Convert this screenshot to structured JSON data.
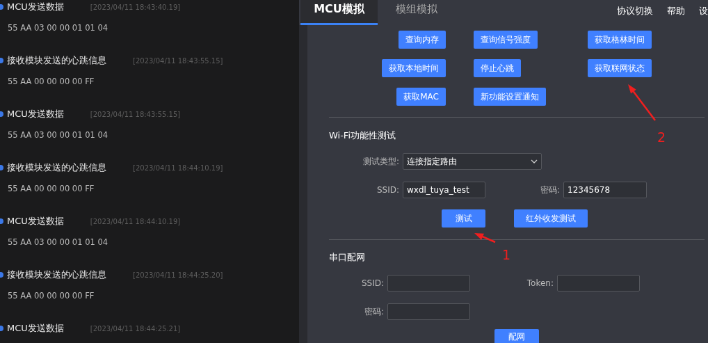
{
  "log": [
    {
      "title": "MCU发送数据",
      "time": "[2023/04/11 18:43:40.19]",
      "data": "55 AA 03 00 00 01 01 04"
    },
    {
      "title": "接收模块发送的心跳信息",
      "time": "[2023/04/11 18:43:55.15]",
      "data": "55 AA 00 00 00 00 FF"
    },
    {
      "title": "MCU发送数据",
      "time": "[2023/04/11 18:43:55.15]",
      "data": "55 AA 03 00 00 01 01 04"
    },
    {
      "title": "接收模块发送的心跳信息",
      "time": "[2023/04/11 18:44:10.19]",
      "data": "55 AA 00 00 00 00 FF"
    },
    {
      "title": "MCU发送数据",
      "time": "[2023/04/11 18:44:10.19]",
      "data": "55 AA 03 00 00 01 01 04"
    },
    {
      "title": "接收模块发送的心跳信息",
      "time": "[2023/04/11 18:44:25.20]",
      "data": "55 AA 00 00 00 00 FF"
    },
    {
      "title": "MCU发送数据",
      "time": "[2023/04/11 18:44:25.21]"
    }
  ],
  "tabs": [
    {
      "label": "MCU模拟",
      "selected": true
    },
    {
      "label": "模组模拟",
      "selected": false
    }
  ],
  "menu": [
    "协议切换",
    "帮助",
    "设"
  ],
  "command_buttons": [
    "查询内存",
    "查询信号强度",
    "获取格林时间",
    "获取本地时间",
    "停止心跳",
    "获取联网状态",
    "获取MAC",
    "新功能设置通知"
  ],
  "wifi_test": {
    "title": "Wi-Fi功能性测试",
    "type_label": "测试类型:",
    "type_value": "连接指定路由",
    "ssid_label": "SSID:",
    "ssid_value": "wxdl_tuya_test",
    "password_label": "密码:",
    "password_value": "12345678",
    "buttons": [
      "测试",
      "红外收发测试"
    ]
  },
  "serial_config": {
    "title": "串口配网",
    "ssid_label": "SSID:",
    "token_label": "Token:",
    "password_label": "密码:",
    "button": "配网"
  },
  "annotations": [
    {
      "label": "2"
    },
    {
      "label": "1"
    }
  ]
}
